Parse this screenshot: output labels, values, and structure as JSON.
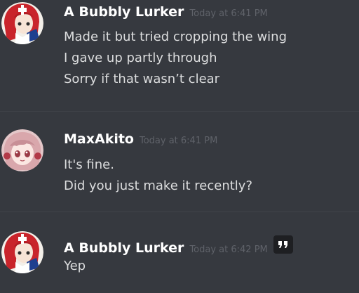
{
  "messages": [
    {
      "username": "A Bubbly Lurker",
      "timestamp": "Today at 6:41 PM",
      "avatar": "anime-girl-avatar",
      "lines": [
        "Made it but tried cropping the wing",
        "I gave up partly through",
        "Sorry if that wasn’t clear"
      ]
    },
    {
      "username": "MaxAkito",
      "timestamp": "Today at 6:41 PM",
      "avatar": "pink-hair-anime-avatar",
      "lines": [
        "It's fine.",
        "Did you just make it recently?"
      ]
    },
    {
      "username": "A Bubbly Lurker",
      "timestamp": "Today at 6:42 PM",
      "avatar": "anime-girl-avatar",
      "lines": [
        "Yep"
      ],
      "hover_action_icon": "quote-icon"
    }
  ],
  "colors": {
    "background": "#36393f",
    "username": "#ffffff",
    "timestamp": "#5f6269",
    "message_text": "#dcddde",
    "divider": "#3f4248"
  }
}
